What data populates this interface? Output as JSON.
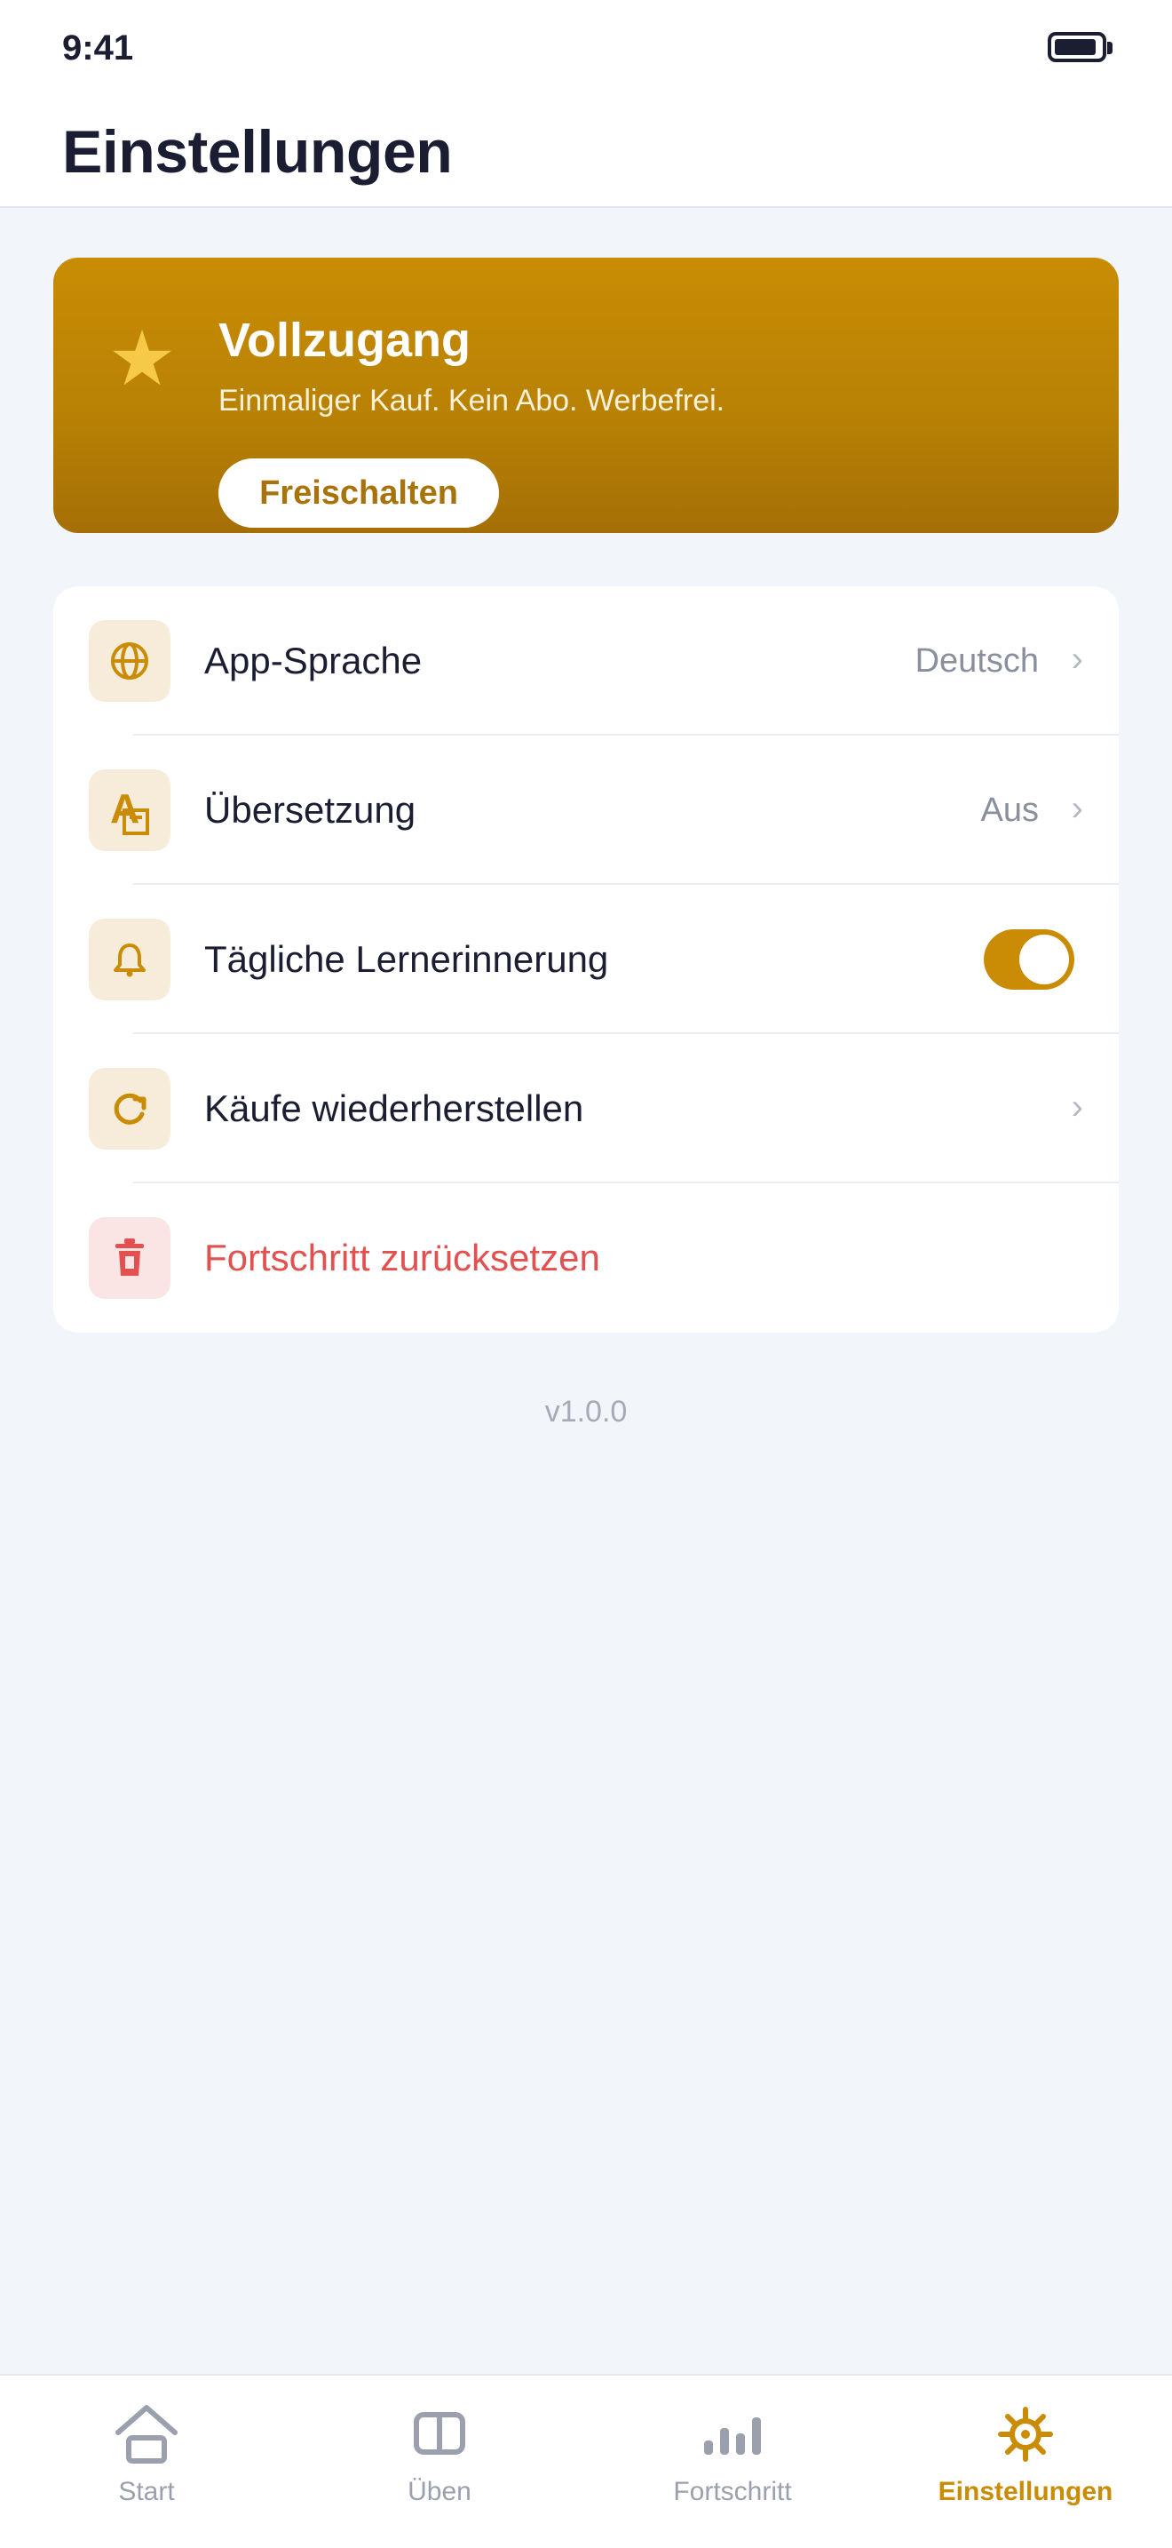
{
  "status_bar": {
    "time": "9:41"
  },
  "header": {
    "title": "Einstellungen"
  },
  "premium": {
    "title": "Vollzugang",
    "subtitle": "Einmaliger Kauf. Kein Abo. Werbefrei.",
    "button_label": "Freischalten",
    "icon": "star-icon"
  },
  "settings": [
    {
      "icon": "globe-icon",
      "label": "App-Sprache",
      "value": "Deutsch",
      "has_chevron": true
    },
    {
      "icon": "translate-icon",
      "label": "Übersetzung",
      "value": "Aus",
      "has_chevron": true
    },
    {
      "icon": "bell-icon",
      "label": "Tägliche Lernerinnerung",
      "toggle": true,
      "toggle_on": true
    },
    {
      "icon": "restore-icon",
      "label": "Käufe wiederherstellen",
      "has_chevron": true
    },
    {
      "icon": "trash-icon",
      "label": "Fortschritt zurücksetzen",
      "destructive": true
    }
  ],
  "chevron": "›",
  "version": "v1.0.0",
  "tabs": [
    {
      "icon": "home-icon",
      "label": "Start",
      "active": false
    },
    {
      "icon": "book-icon",
      "label": "Üben",
      "active": false
    },
    {
      "icon": "chart-icon",
      "label": "Fortschritt",
      "active": false
    },
    {
      "icon": "gear-icon",
      "label": "Einstellungen",
      "active": true
    }
  ],
  "colors": {
    "accent": "#c98c04",
    "danger": "#e35050",
    "icon_bg": "#f7ecd9",
    "danger_bg": "#fbe4e4",
    "inactive_tab": "#9aa0ad"
  }
}
